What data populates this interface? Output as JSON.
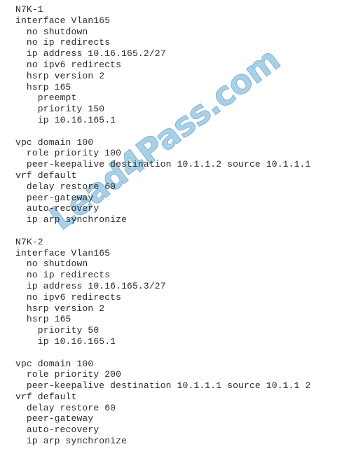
{
  "document": {
    "type": "network-device-configuration-snippet",
    "background_color": "#ffffff",
    "text_color": "#2b2b2b"
  },
  "watermark": {
    "text": "Lead4Pass.com",
    "color": "#a9d0e6",
    "outline_color": "#7fb6d6",
    "rotation_degrees": -37
  },
  "config": {
    "devices": [
      {
        "name": "N7K-1",
        "lines": [
          "N7K-1",
          "interface Vlan165",
          "  no shutdown",
          "  no ip redirects",
          "  ip address 10.16.165.2/27",
          "  no ipv6 redirects",
          "  hsrp version 2",
          "  hsrp 165",
          "    preempt",
          "    priority 150",
          "    ip 10.16.165.1",
          "",
          "vpc domain 100",
          "  role priority 100",
          "  peer-keepalive destination 10.1.1.2 source 10.1.1.1",
          "vrf default",
          "  delay restore 60",
          "  peer-gateway",
          "  auto-recovery",
          "  ip arp synchronize"
        ]
      },
      {
        "name": "N7K-2",
        "lines": [
          "N7K-2",
          "interface Vlan165",
          "  no shutdown",
          "  no ip redirects",
          "  ip address 10.16.165.3/27",
          "  no ipv6 redirects",
          "  hsrp version 2",
          "  hsrp 165",
          "    priority 50",
          "    ip 10.16.165.1",
          "",
          "vpc domain 100",
          "  role priority 200",
          "  peer-keepalive destination 10.1.1.1 source 10.1.1 2",
          "vrf default",
          "  delay restore 60",
          "  peer-gateway",
          "  auto-recovery",
          "  ip arp synchronize"
        ]
      }
    ],
    "separator_between_devices": ""
  }
}
